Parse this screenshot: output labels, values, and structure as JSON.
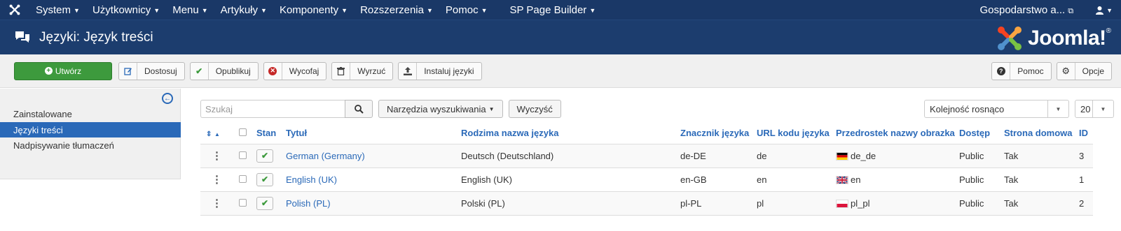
{
  "topnav": {
    "menu": [
      {
        "label": "System"
      },
      {
        "label": "Użytkownicy"
      },
      {
        "label": "Menu"
      },
      {
        "label": "Artykuły"
      },
      {
        "label": "Komponenty"
      },
      {
        "label": "Rozszerzenia"
      },
      {
        "label": "Pomoc"
      },
      {
        "label": "SP Page Builder"
      }
    ],
    "site_label": "Gospodarstwo a...",
    "user_icon": "user-icon"
  },
  "header": {
    "title": "Języki: Język treści",
    "logo_text": "Joomla!",
    "logo_mark": "®"
  },
  "toolbar": {
    "buttons": [
      {
        "label": "Utwórz",
        "icon": "plus-circle-icon"
      },
      {
        "label": "Dostosuj",
        "icon": "edit-icon"
      },
      {
        "label": "Opublikuj",
        "icon": "check-icon"
      },
      {
        "label": "Wycofaj",
        "icon": "unpublish-icon"
      },
      {
        "label": "Wyrzuć",
        "icon": "trash-icon"
      },
      {
        "label": "Instaluj języki",
        "icon": "upload-icon"
      }
    ],
    "right": [
      {
        "label": "Pomoc",
        "icon": "question-icon"
      },
      {
        "label": "Opcje",
        "icon": "gear-icon"
      }
    ]
  },
  "sidebar": {
    "items": [
      {
        "label": "Zainstalowane",
        "active": false
      },
      {
        "label": "Języki treści",
        "active": true
      },
      {
        "label": "Nadpisywanie tłumaczeń",
        "active": false
      }
    ]
  },
  "filters": {
    "search_placeholder": "Szukaj",
    "search_tools": "Narzędzia wyszukiwania",
    "clear": "Wyczyść",
    "ordering": "Kolejność rosnąco",
    "limit": "20"
  },
  "table": {
    "headers": {
      "status": "Stan",
      "title": "Tytuł",
      "native": "Rodzima nazwa języka",
      "tag": "Znacznik języka",
      "url": "URL kodu języka",
      "image": "Przedrostek nazwy obrazka",
      "access": "Dostęp",
      "home": "Strona domowa",
      "id": "ID"
    },
    "rows": [
      {
        "title": "German (Germany)",
        "native": "Deutsch (Deutschland)",
        "tag": "de-DE",
        "url": "de",
        "image": "de_de",
        "flag": "de",
        "access": "Public",
        "home": "Tak",
        "id": "3"
      },
      {
        "title": "English (UK)",
        "native": "English (UK)",
        "tag": "en-GB",
        "url": "en",
        "image": "en",
        "flag": "gb",
        "access": "Public",
        "home": "Tak",
        "id": "1"
      },
      {
        "title": "Polish (PL)",
        "native": "Polski (PL)",
        "tag": "pl-PL",
        "url": "pl",
        "image": "pl_pl",
        "flag": "pl",
        "access": "Public",
        "home": "Tak",
        "id": "2"
      }
    ]
  },
  "colors": {
    "nav_bg": "#1a3867",
    "header_bg": "#1c3d6e",
    "accent": "#2a69b8",
    "success": "#3d9a3d"
  }
}
